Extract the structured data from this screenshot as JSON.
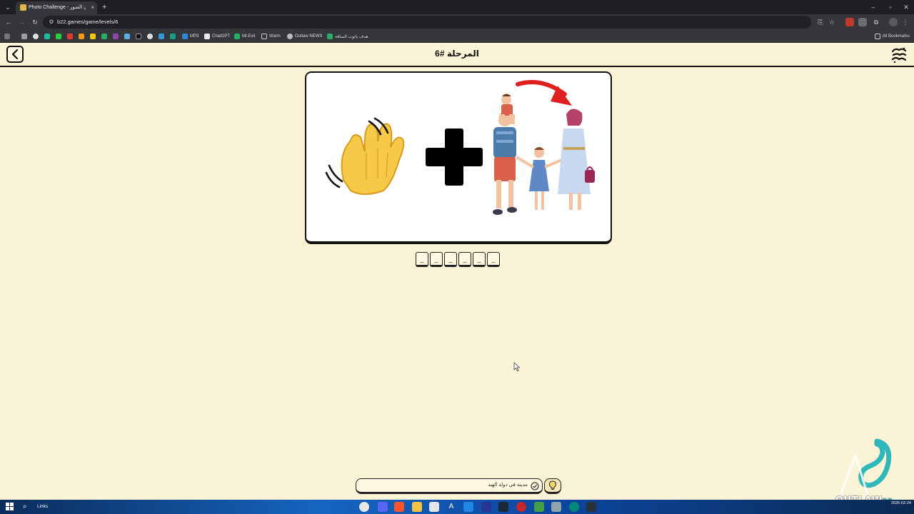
{
  "browser": {
    "tab_title": "Photo Challenge - تحدي الصور",
    "tab_close": "×",
    "new_tab": "+",
    "url": "b22.games/game/levels/6",
    "window_controls": {
      "minimize": "–",
      "maximize": "▫",
      "close": "✕"
    },
    "bookmarks": [
      {
        "label": "MP3"
      },
      {
        "label": "ChatGPT"
      },
      {
        "label": "Mr.Evil"
      },
      {
        "label": "Warm"
      },
      {
        "label": "Outlaw NEWS"
      },
      {
        "label": "هدف بانوت الساقة"
      }
    ],
    "all_bookmarks": "All Bookmarks"
  },
  "game": {
    "level_title": "المرحلة #6",
    "answer_slots": [
      "_",
      "_",
      "_",
      "_",
      "_",
      "_"
    ],
    "hint_text": "مدينة في دولة الهند",
    "puzzle_icons": [
      "waving-hand",
      "plus-sign",
      "family",
      "red-arrow"
    ]
  },
  "watermark": {
    "text": "OUTLAW",
    "suffix": "RP"
  },
  "taskbar": {
    "search_label": "Links",
    "tray_date": "2026-02-24"
  },
  "colors": {
    "page_bg": "#fbf3d6",
    "card_bg": "#ffffff",
    "border": "#111111",
    "browser_dark": "#35363a"
  }
}
